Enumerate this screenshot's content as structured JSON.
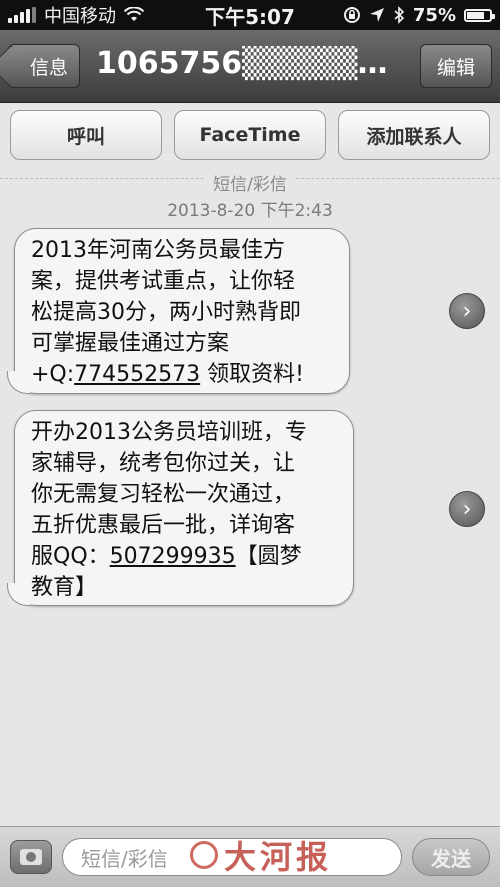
{
  "status_bar": {
    "carrier": "中国移动",
    "time": "下午5:07",
    "battery": "75%",
    "battery_level": 0.75
  },
  "nav": {
    "back_label": "信息",
    "title": "1065756▒▒▒▒▒702...",
    "edit_label": "编辑"
  },
  "actions": {
    "call": "呼叫",
    "facetime": "FaceTime",
    "add_contact": "添加联系人"
  },
  "thread": {
    "type_label": "短信/彩信",
    "timestamp": "2013-8-20 下午2:43"
  },
  "messages": [
    {
      "lines": [
        "2013年河南公务员最佳方",
        "案，提供考试重点，让你轻",
        "松提高30分，两小时熟背即",
        "可掌握最佳通过方案"
      ],
      "prefix": "+Q:",
      "number": "774552573",
      "suffix": " 领取资料!"
    },
    {
      "lines": [
        "开办2013公务员培训班，专",
        "家辅导，统考包你过关，让",
        "你无需复习轻松一次通过，",
        "五折优惠最后一批，详询客"
      ],
      "prefix": "服QQ：",
      "number": "507299935",
      "suffix": "【圆梦",
      "last_line": "教育】"
    }
  ],
  "input": {
    "placeholder": "短信/彩信",
    "send_label": "发送"
  },
  "watermark": "大河报"
}
